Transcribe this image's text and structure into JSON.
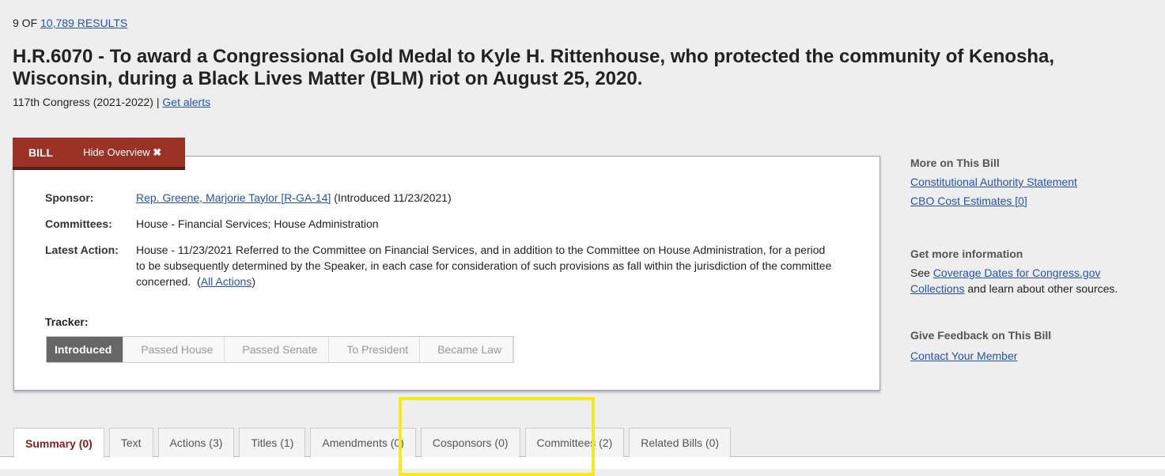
{
  "results": {
    "prefix": "9 OF",
    "count": "10,789 RESULTS"
  },
  "title": "H.R.6070 - To award a Congressional Gold Medal to Kyle H. Rittenhouse, who protected the community of Kenosha, Wisconsin, during a Black Lives Matter (BLM) riot on August 25, 2020.",
  "congress": {
    "text": "117th Congress (2021-2022) |",
    "alerts": "Get alerts"
  },
  "overview": {
    "tab_label": "BILL",
    "hide_label": "Hide Overview",
    "close_icon": "close-icon",
    "sponsor_label": "Sponsor:",
    "sponsor_link": "Rep. Greene, Marjorie Taylor [R-GA-14]",
    "sponsor_extra": "(Introduced 11/23/2021)",
    "committees_label": "Committees:",
    "committees": "House - Financial Services; House Administration",
    "latest_label": "Latest Action:",
    "latest": "House - 11/23/2021 Referred to the Committee on Financial Services, and in addition to the Committee on House Administration, for a period to be subsequently determined by the Speaker, in each case for consideration of such provisions as fall within the jurisdiction of the committee concerned.",
    "all_actions": "All Actions",
    "tracker_label": "Tracker:",
    "tracker": [
      "Introduced",
      "Passed House",
      "Passed Senate",
      "To President",
      "Became Law"
    ],
    "tracker_current": "Introduced"
  },
  "sidebar": {
    "more": {
      "heading": "More on This Bill",
      "links": [
        "Constitutional Authority Statement",
        "CBO Cost Estimates [0]"
      ]
    },
    "info": {
      "heading": "Get more information",
      "pre": "See",
      "link": "Coverage Dates for Congress.gov Collections",
      "post": "and learn about other sources."
    },
    "feedback": {
      "heading": "Give Feedback on This Bill",
      "link": "Contact Your Member"
    }
  },
  "tabs": [
    "Summary (0)",
    "Text",
    "Actions (3)",
    "Titles (1)",
    "Amendments (0)",
    "Cosponsors (0)",
    "Committees (2)",
    "Related Bills (0)"
  ],
  "active_tab": "Summary (0)",
  "colors": {
    "accent": "#9a3326",
    "link": "#2552b5",
    "highlight": "#f5ea1a"
  }
}
